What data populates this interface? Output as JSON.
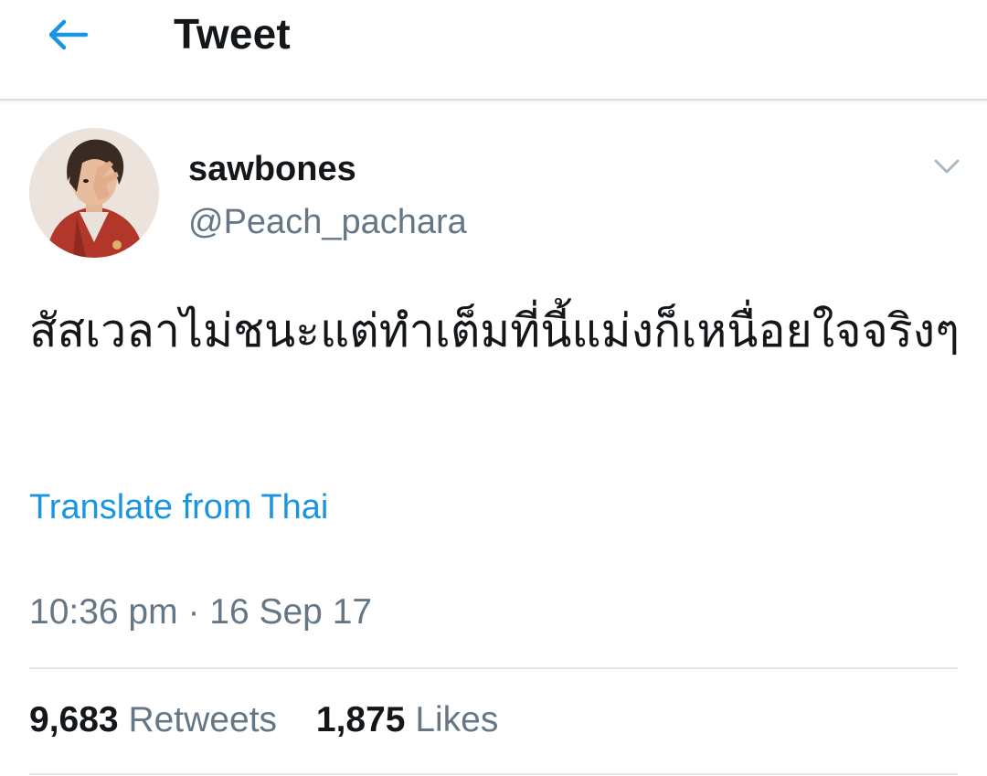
{
  "header": {
    "title": "Tweet",
    "back_icon": "arrow-left-icon"
  },
  "tweet": {
    "author": {
      "display_name": "sawbones",
      "handle": "@Peach_pachara",
      "avatar_icon": "user-avatar"
    },
    "menu_icon": "chevron-down-icon",
    "text": "สัสเวลาไม่ชนะแต่ทำเต็มที่นี้แม่งก็เหนื่อยใจจริงๆ",
    "translate_label": "Translate from Thai",
    "timestamp": "10:36 pm · 16 Sep 17",
    "stats": {
      "retweets_count": "9,683",
      "retweets_label": "Retweets",
      "likes_count": "1,875",
      "likes_label": "Likes"
    }
  },
  "colors": {
    "accent": "#1b95e0",
    "text_primary": "#14171a",
    "text_secondary": "#657786",
    "divider": "#e1e8ed"
  }
}
